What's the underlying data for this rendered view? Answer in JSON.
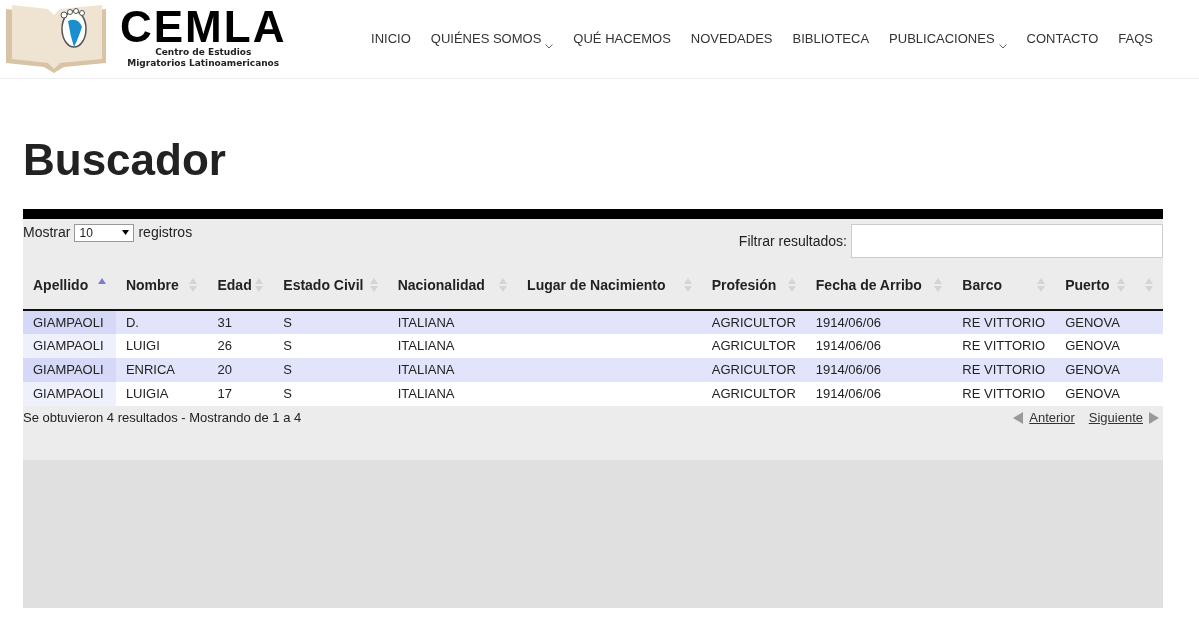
{
  "logo": {
    "title": "CEMLA",
    "subtitle_lines": [
      "Centro de Estudios",
      "Migratorios Latinoamericanos"
    ]
  },
  "nav": [
    {
      "label": "INICIO",
      "has_dropdown": false
    },
    {
      "label": "QUIÉNES SOMOS",
      "has_dropdown": true
    },
    {
      "label": "QUÉ HACEMOS",
      "has_dropdown": false
    },
    {
      "label": "NOVEDADES",
      "has_dropdown": false
    },
    {
      "label": "BIBLIOTECA",
      "has_dropdown": false
    },
    {
      "label": "PUBLICACIONES",
      "has_dropdown": true
    },
    {
      "label": "CONTACTO",
      "has_dropdown": false
    },
    {
      "label": "FAQS",
      "has_dropdown": false
    }
  ],
  "heading": "Buscador",
  "length_control": {
    "before": "Mostrar",
    "value": "10",
    "after": "registros"
  },
  "filter": {
    "label": "Filtrar resultados:"
  },
  "table": {
    "columns": [
      {
        "label": "Apellido",
        "sorted": true
      },
      {
        "label": "Nombre",
        "sorted": false
      },
      {
        "label": "Edad",
        "sorted": false
      },
      {
        "label": "Estado Civil",
        "sorted": false
      },
      {
        "label": "Nacionalidad",
        "sorted": false
      },
      {
        "label": "Lugar de Nacimiento",
        "sorted": false
      },
      {
        "label": "Profesión",
        "sorted": false
      },
      {
        "label": "Fecha de Arribo",
        "sorted": false
      },
      {
        "label": "Barco",
        "sorted": false
      },
      {
        "label": "Puerto",
        "sorted": false
      },
      {
        "sorted": false
      }
    ],
    "rows": [
      [
        "GIAMPAOLI",
        "D.",
        "31",
        "S",
        "ITALIANA",
        "",
        "AGRICULTOR",
        "1914/06/06",
        "RE VITTORIO",
        "GENOVA"
      ],
      [
        "GIAMPAOLI",
        "LUIGI",
        "26",
        "S",
        "ITALIANA",
        "",
        "AGRICULTOR",
        "1914/06/06",
        "RE VITTORIO",
        "GENOVA"
      ],
      [
        "GIAMPAOLI",
        "ENRICA",
        "20",
        "S",
        "ITALIANA",
        "",
        "AGRICULTOR",
        "1914/06/06",
        "RE VITTORIO",
        "GENOVA"
      ],
      [
        "GIAMPAOLI",
        "LUIGIA",
        "17",
        "S",
        "ITALIANA",
        "",
        "AGRICULTOR",
        "1914/06/06",
        "RE VITTORIO",
        "GENOVA"
      ]
    ]
  },
  "info": "Se obtuvieron 4 resultados - Mostrando de 1 a 4",
  "pagination": {
    "previous": "Anterior",
    "next": "Siguiente"
  }
}
